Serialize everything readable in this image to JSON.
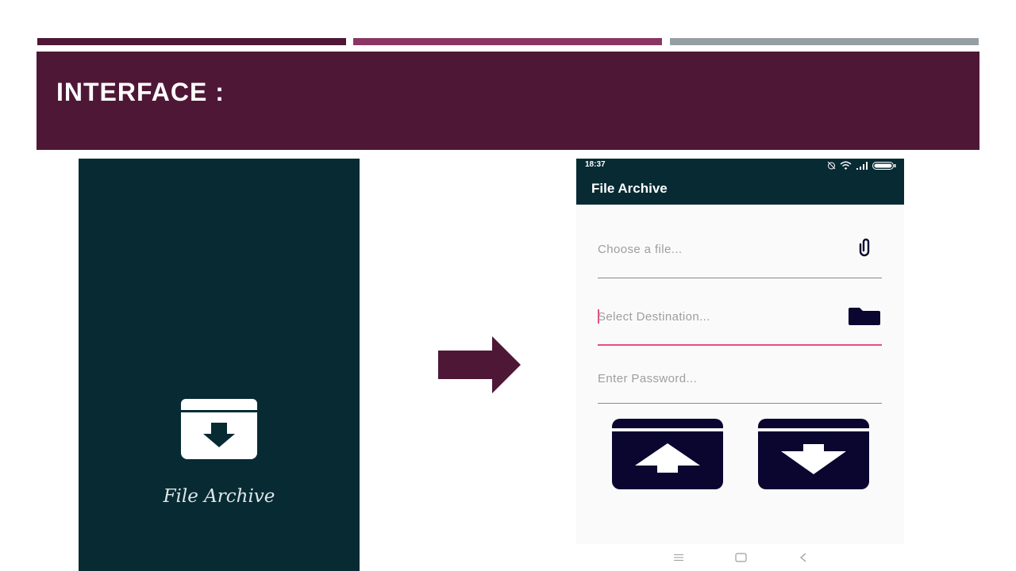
{
  "slide": {
    "title": "INTERFACE :",
    "colors": {
      "stripe1": "#4f1736",
      "stripe2": "#8b3564",
      "stripe3": "#969ea5",
      "band": "#4f1736",
      "arrow": "#4f1736"
    }
  },
  "splash": {
    "app_name": "File Archive",
    "icon": "archive-download-icon",
    "colors": {
      "background": "#072a33",
      "icon": "#ffffff"
    }
  },
  "phone": {
    "status_bar": {
      "time": "18:37",
      "icons": [
        "alarm-off-icon",
        "wifi-icon",
        "signal-icon",
        "battery-icon"
      ]
    },
    "app_bar": {
      "title": "File Archive"
    },
    "fields": {
      "file": {
        "placeholder": "Choose a file...",
        "icon": "paperclip-icon"
      },
      "destination": {
        "placeholder": "Select Destination...",
        "icon": "folder-icon"
      },
      "password": {
        "placeholder": "Enter Password..."
      }
    },
    "actions": {
      "archive_icon": "archive-upload-icon",
      "extract_icon": "archive-download-icon"
    },
    "nav_bar": {
      "icons": [
        "menu-icon",
        "home-icon",
        "back-icon"
      ]
    },
    "colors": {
      "app_bar": "#072a33",
      "accent": "#e54f7e",
      "button": "#0a0630"
    }
  }
}
